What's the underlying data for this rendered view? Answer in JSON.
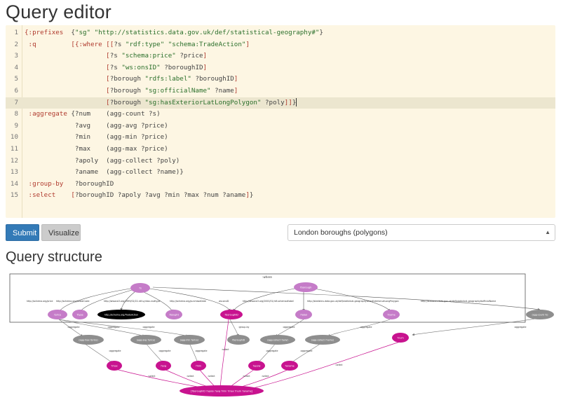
{
  "page": {
    "title": "Query editor",
    "structure_title": "Query structure"
  },
  "editor": {
    "lines": [
      {
        "n": "1",
        "tokens": [
          [
            "kw",
            "{:prefixes"
          ],
          [
            "plain",
            "  {"
          ],
          [
            "str",
            "\"sg\" \"http://statistics.data.gov.uk/def/statistical-geography#\""
          ],
          [
            "plain",
            "}"
          ]
        ]
      },
      {
        "n": "2",
        "tokens": [
          [
            "kw",
            " :q"
          ],
          [
            "plain",
            "         "
          ],
          [
            "br",
            "[{"
          ],
          [
            "kw",
            ":where"
          ],
          [
            "plain",
            " "
          ],
          [
            "br",
            "[["
          ],
          [
            "plain",
            "?s "
          ],
          [
            "str",
            "\"rdf:type\" \"schema:TradeAction\""
          ],
          [
            "br",
            "]"
          ]
        ]
      },
      {
        "n": "3",
        "tokens": [
          [
            "plain",
            "                     "
          ],
          [
            "br",
            "["
          ],
          [
            "plain",
            "?s "
          ],
          [
            "str",
            "\"schema:price\""
          ],
          [
            "plain",
            " ?price"
          ],
          [
            "br",
            "]"
          ]
        ]
      },
      {
        "n": "4",
        "tokens": [
          [
            "plain",
            "                     "
          ],
          [
            "br",
            "["
          ],
          [
            "plain",
            "?s "
          ],
          [
            "str",
            "\"ws:onsID\""
          ],
          [
            "plain",
            " ?boroughID"
          ],
          [
            "br",
            "]"
          ]
        ]
      },
      {
        "n": "5",
        "tokens": [
          [
            "plain",
            "                     "
          ],
          [
            "br",
            "["
          ],
          [
            "plain",
            "?borough "
          ],
          [
            "str",
            "\"rdfs:label\""
          ],
          [
            "plain",
            " ?boroughID"
          ],
          [
            "br",
            "]"
          ]
        ]
      },
      {
        "n": "6",
        "tokens": [
          [
            "plain",
            "                     "
          ],
          [
            "br",
            "["
          ],
          [
            "plain",
            "?borough "
          ],
          [
            "str",
            "\"sg:officialName\""
          ],
          [
            "plain",
            " ?name"
          ],
          [
            "br",
            "]"
          ]
        ]
      },
      {
        "n": "7",
        "tokens": [
          [
            "plain",
            "                     "
          ],
          [
            "br",
            "["
          ],
          [
            "plain",
            "?borough "
          ],
          [
            "str",
            "\"sg:hasExteriorLatLongPolygon\""
          ],
          [
            "plain",
            " ?poly"
          ],
          [
            "br",
            "]]"
          ],
          [
            "plain",
            "}"
          ]
        ],
        "active": true
      },
      {
        "n": "8",
        "tokens": [
          [
            "kw",
            " :aggregate"
          ],
          [
            "plain",
            " {?num    (agg-count ?s)"
          ]
        ]
      },
      {
        "n": "9",
        "tokens": [
          [
            "plain",
            "             ?avg    (agg-avg ?price)"
          ]
        ]
      },
      {
        "n": "10",
        "tokens": [
          [
            "plain",
            "             ?min    (agg-min ?price)"
          ]
        ]
      },
      {
        "n": "11",
        "tokens": [
          [
            "plain",
            "             ?max    (agg-max ?price)"
          ]
        ]
      },
      {
        "n": "12",
        "tokens": [
          [
            "plain",
            "             ?apoly  (agg-collect ?poly)"
          ]
        ]
      },
      {
        "n": "13",
        "tokens": [
          [
            "plain",
            "             ?aname  (agg-collect ?name)}"
          ]
        ]
      },
      {
        "n": "14",
        "tokens": [
          [
            "kw",
            " :group-by"
          ],
          [
            "plain",
            "   ?boroughID"
          ]
        ]
      },
      {
        "n": "15",
        "tokens": [
          [
            "kw",
            " :select"
          ],
          [
            "plain",
            "    "
          ],
          [
            "br",
            "["
          ],
          [
            "plain",
            "?boroughID ?apoly ?avg ?min ?max ?num ?aname"
          ],
          [
            "br",
            "]"
          ],
          [
            "plain",
            "}"
          ]
        ]
      }
    ]
  },
  "toolbar": {
    "submit_label": "Submit",
    "visualize_label": "Visualize",
    "dataset_selected": "London boroughs (polygons)"
  },
  "graph": {
    "where_label": ":where",
    "nodes": {
      "s": "?s",
      "borough": "?borough",
      "price": "?price",
      "type": "?type",
      "trade_action": "http://schema.org/TradeAction",
      "bought": "?bought",
      "borough_id": "?boroughID",
      "label": "?label",
      "name": "?name",
      "count_s": "(agg-count ?s)",
      "agg_max": "(agg-max ?price)",
      "agg_avg": "(agg-avg ?price)",
      "agg_min": "(agg-min ?price)",
      "gb_borough": "?boroughID",
      "agg_collect_poly": "(agg-collect ?poly)",
      "agg_collect_name": "(agg-collect ?name)",
      "num": "?num",
      "max": "?max",
      "avg": "?avg",
      "min": "?min",
      "apoly": "?apoly",
      "aname": "?aname",
      "select": "[?boroughID ?apoly ?avg ?min ?max ?num ?aname]"
    },
    "edges": {
      "e1": "http://schema.org/price",
      "e2": "http://schema.org/postalCode",
      "e3": "http://www.w3.org/1999/02/22-rdf-syntax-ns#type",
      "e4": "http://schema.org/purchaseDate",
      "e5": "ws:onsID",
      "e6": "http://www.w3.org/2000/01/rdf-schema#label",
      "e7": "http://statistics.data.gov.uk/def/statistical-geography#hasExteriorLatLongPolygon",
      "e8": "http://statistics.data.gov.uk/def/statistical-geography#officialName",
      "aggregate": ":aggregate",
      "group_by": ":group-by",
      "select": ":select"
    },
    "colors": {
      "var_node": "#c57cc8",
      "agg_node": "#8e8e8e",
      "out_node": "#c8138f",
      "const_node": "#000000",
      "select_edge": "#c8138f"
    }
  }
}
